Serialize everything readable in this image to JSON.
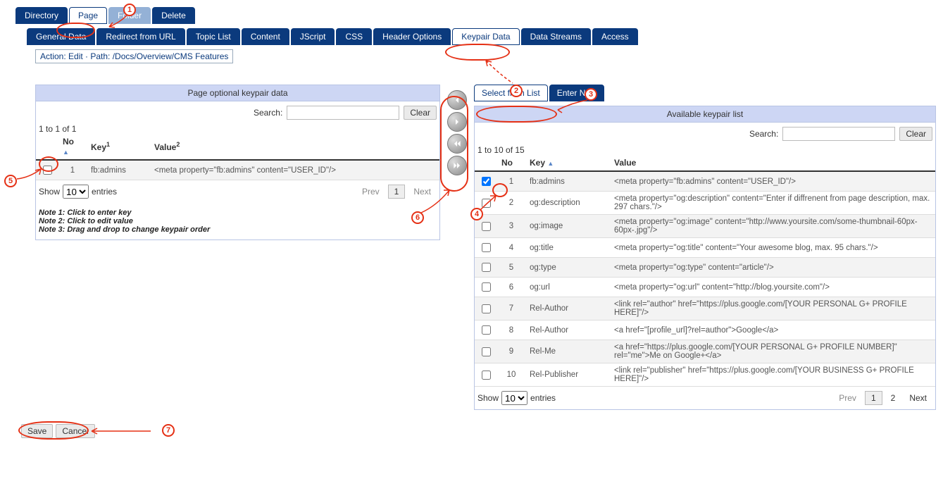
{
  "top_tabs": {
    "items": [
      "Directory",
      "Page",
      "Folder",
      "Delete"
    ],
    "active": 1,
    "faded": 2
  },
  "sub_tabs": {
    "items": [
      "General Data",
      "Redirect from URL",
      "Topic List",
      "Content",
      "JScript",
      "CSS",
      "Header Options",
      "Keypair Data",
      "Data Streams",
      "Access"
    ],
    "active": 7
  },
  "path_line": "Action: Edit · Path: /Docs/Overview/CMS Features",
  "left_panel": {
    "title": "Page optional keypair data",
    "search_label": "Search:",
    "search_value": "",
    "clear_label": "Clear",
    "count_label": "1 to 1 of 1",
    "columns": [
      "",
      "No",
      "Key",
      "Value"
    ],
    "col_sup": {
      "key": "1",
      "value": "2"
    },
    "rows": [
      {
        "checked": false,
        "no": "1",
        "key": "fb:admins",
        "value": "<meta property=\"fb:admins\" content=\"USER_ID\"/>"
      }
    ],
    "show_label": "Show",
    "entries_label": "entries",
    "page_size": "10",
    "pager": {
      "prev": "Prev",
      "next": "Next",
      "pages": [
        "1"
      ],
      "active": 0
    },
    "notes": [
      "Note 1: Click to enter key",
      "Note 2: Click to edit value",
      "Note 3: Drag and drop to change keypair order"
    ]
  },
  "transfer": {
    "move_left": "move-left",
    "move_right": "move-right",
    "move_all_left": "move-all-left",
    "move_all_right": "move-all-right"
  },
  "right_tabs": {
    "items": [
      "Select from List",
      "Enter New"
    ],
    "active": 0
  },
  "right_panel": {
    "title": "Available keypair list",
    "search_label": "Search:",
    "search_value": "",
    "clear_label": "Clear",
    "count_label": "1 to 10 of 15",
    "columns": [
      "",
      "No",
      "Key",
      "Value"
    ],
    "rows": [
      {
        "checked": true,
        "no": "1",
        "key": "fb:admins",
        "value": "<meta property=\"fb:admins\" content=\"USER_ID\"/>"
      },
      {
        "checked": false,
        "no": "2",
        "key": "og:description",
        "value": "<meta property=\"og:description\" content=\"Enter if diffrenent from page description, max. 297 chars.\"/>"
      },
      {
        "checked": false,
        "no": "3",
        "key": "og:image",
        "value": "<meta property=\"og:image\" content=\"http://www.yoursite.com/some-thumbnail-60px-60px-.jpg\"/>"
      },
      {
        "checked": false,
        "no": "4",
        "key": "og:title",
        "value": "<meta property=\"og:title\" content=\"Your awesome blog, max. 95 chars.\"/>"
      },
      {
        "checked": false,
        "no": "5",
        "key": "og:type",
        "value": "<meta property=\"og:type\" content=\"article\"/>"
      },
      {
        "checked": false,
        "no": "6",
        "key": "og:url",
        "value": "<meta property=\"og:url\" content=\"http://blog.yoursite.com\"/>"
      },
      {
        "checked": false,
        "no": "7",
        "key": "Rel-Author",
        "value": "<link rel=\"author\" href=\"https://plus.google.com/[YOUR PERSONAL G+ PROFILE HERE]\"/>"
      },
      {
        "checked": false,
        "no": "8",
        "key": "Rel-Author",
        "value": "<a href=\"[profile_url]?rel=author\">Google</a>"
      },
      {
        "checked": false,
        "no": "9",
        "key": "Rel-Me",
        "value": "<a href=\"https://plus.google.com/[YOUR PERSONAL G+ PROFILE NUMBER]\" rel=\"me\">Me on Google+</a>"
      },
      {
        "checked": false,
        "no": "10",
        "key": "Rel-Publisher",
        "value": "<link rel=\"publisher\" href=\"https://plus.google.com/[YOUR BUSINESS G+ PROFILE HERE]\"/>"
      }
    ],
    "show_label": "Show",
    "entries_label": "entries",
    "page_size": "10",
    "pager": {
      "prev": "Prev",
      "next": "Next",
      "pages": [
        "1",
        "2"
      ],
      "active": 0
    }
  },
  "bottom": {
    "save": "Save",
    "cancel": "Cancel"
  },
  "annotations": {
    "1": "1",
    "2": "2",
    "3": "3",
    "4": "4",
    "5": "5",
    "6": "6",
    "7": "7"
  }
}
